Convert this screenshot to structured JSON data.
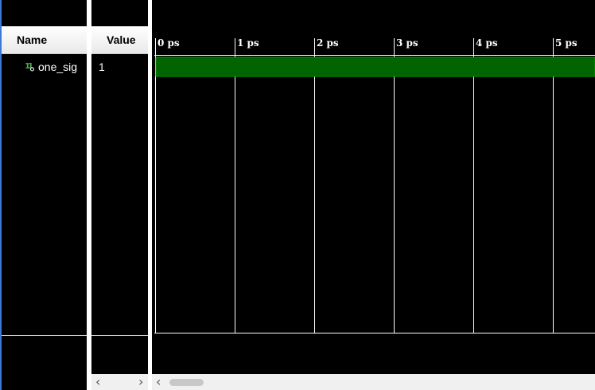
{
  "name_header": "Name",
  "value_header": "Value",
  "signals": [
    {
      "name": "one_sig",
      "value": "1",
      "icon": "single-bit-signal-icon"
    }
  ],
  "timeline": {
    "ticks": [
      "0 ps",
      "1 ps",
      "2 ps",
      "3 ps",
      "4 ps",
      "5 ps"
    ],
    "waveform_color": "#006400",
    "grid_color": "#ffffff",
    "signal_icon_color": "#4caf50"
  },
  "scroll_left_icon": "chevron-left-icon",
  "scroll_right_icon": "chevron-right-icon"
}
